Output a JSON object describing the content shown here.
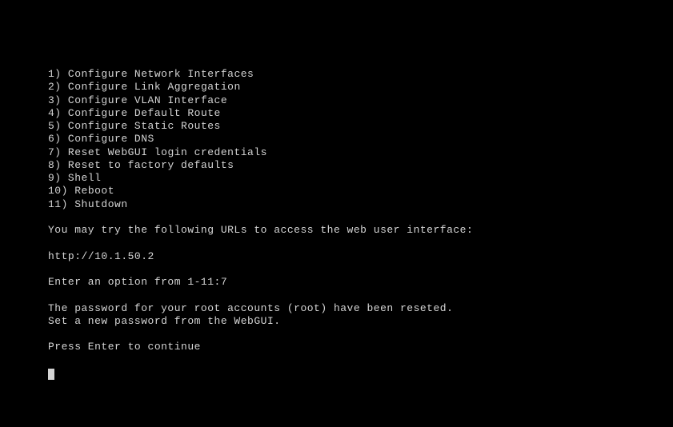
{
  "menu": {
    "items": [
      {
        "num": "1)",
        "label": "Configure Network Interfaces"
      },
      {
        "num": "2)",
        "label": "Configure Link Aggregation"
      },
      {
        "num": "3)",
        "label": "Configure VLAN Interface"
      },
      {
        "num": "4)",
        "label": "Configure Default Route"
      },
      {
        "num": "5)",
        "label": "Configure Static Routes"
      },
      {
        "num": "6)",
        "label": "Configure DNS"
      },
      {
        "num": "7)",
        "label": "Reset WebGUI login credentials"
      },
      {
        "num": "8)",
        "label": "Reset to factory defaults"
      },
      {
        "num": "9)",
        "label": "Shell"
      },
      {
        "num": "10)",
        "label": "Reboot"
      },
      {
        "num": "11)",
        "label": "Shutdown"
      }
    ]
  },
  "url_hint": "You may try the following URLs to access the web user interface:",
  "url": "http://10.1.50.2",
  "prompt_label": "Enter an option from 1-11: ",
  "prompt_value": "7",
  "result_line1": "The password for your root accounts (root) have been reseted.",
  "result_line2": "Set a new password from the WebGUI.",
  "continue_prompt": "Press Enter to continue"
}
